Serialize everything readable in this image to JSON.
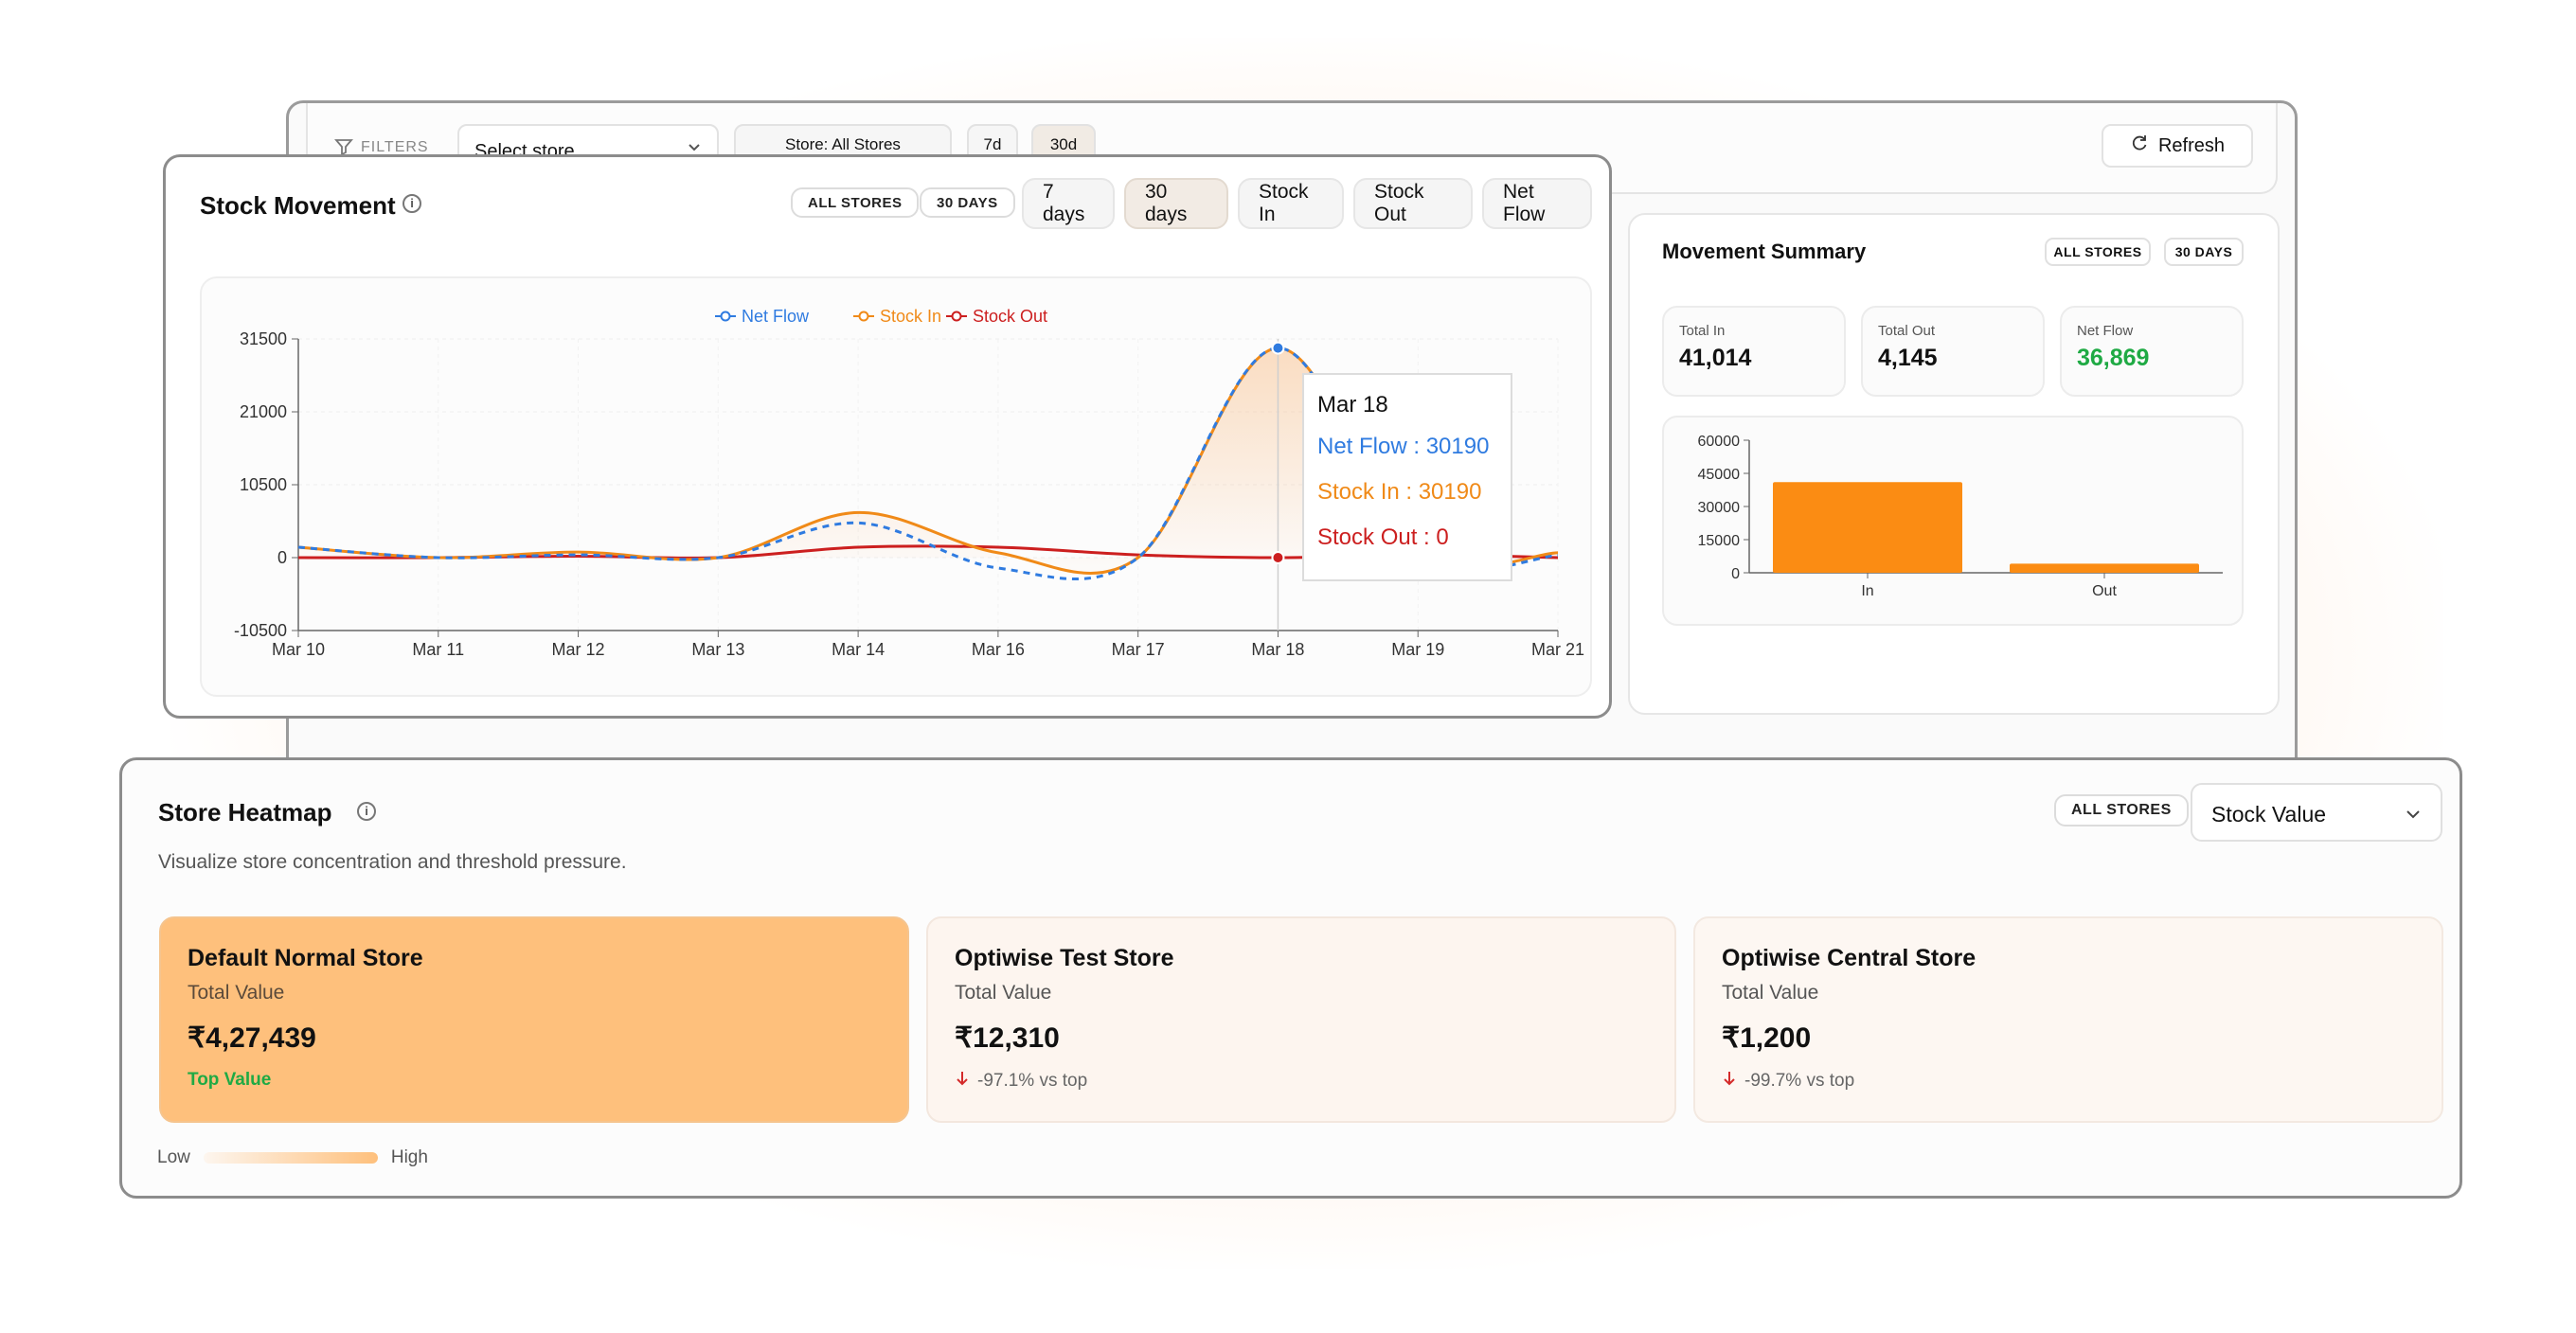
{
  "filters": {
    "label": "FILTERS",
    "store_select": "Select store",
    "chip_store": "Store: All Stores",
    "chip_7d": "7d",
    "chip_30d": "30d",
    "refresh": "Refresh"
  },
  "stock_movement": {
    "title": "Stock Movement",
    "chip_stores": "ALL STORES",
    "chip_days": "30 DAYS",
    "buttons": [
      "7 days",
      "30 days",
      "Stock In",
      "Stock Out",
      "Net Flow"
    ],
    "active_button": "30 days",
    "tooltip": {
      "date": "Mar 18",
      "net_flow": "Net Flow : 30190",
      "stock_in": "Stock In : 30190",
      "stock_out": "Stock Out : 0"
    }
  },
  "chart_data": [
    {
      "type": "line",
      "title": "",
      "x": [
        "Mar 10",
        "Mar 11",
        "Mar 12",
        "Mar 13",
        "Mar 14",
        "Mar 16",
        "Mar 17",
        "Mar 18",
        "Mar 19",
        "Mar 21"
      ],
      "series": [
        {
          "name": "Net Flow",
          "color": "#2f7be0",
          "values": [
            1500,
            0,
            400,
            0,
            5000,
            -1500,
            0,
            30190,
            500,
            300
          ]
        },
        {
          "name": "Stock In",
          "color": "#f08a18",
          "values": [
            1500,
            0,
            800,
            0,
            6500,
            700,
            0,
            30190,
            900,
            700
          ]
        },
        {
          "name": "Stock Out",
          "color": "#cc1f1f",
          "values": [
            0,
            0,
            200,
            0,
            1500,
            1500,
            400,
            0,
            400,
            0
          ]
        }
      ],
      "yticks": [
        31500,
        21000,
        10500,
        0,
        -10500
      ],
      "ylim": [
        -10500,
        31500
      ],
      "legend": "top-center",
      "grid": true
    },
    {
      "type": "bar",
      "title": "",
      "categories": [
        "In",
        "Out"
      ],
      "values": [
        41014,
        4145
      ],
      "color": "#fb8c13",
      "yticks": [
        60000,
        45000,
        30000,
        15000,
        0
      ],
      "ylim": [
        0,
        60000
      ]
    }
  ],
  "movement_summary": {
    "title": "Movement Summary",
    "chip_stores": "ALL STORES",
    "chip_days": "30 DAYS",
    "total_in_label": "Total In",
    "total_in": "41,014",
    "total_out_label": "Total Out",
    "total_out": "4,145",
    "net_flow_label": "Net Flow",
    "net_flow": "36,869",
    "net_color": "#1faa44"
  },
  "heatmap": {
    "title": "Store Heatmap",
    "subtitle": "Visualize store concentration and threshold pressure.",
    "chip_stores": "ALL STORES",
    "metric_select": "Stock Value",
    "stores": [
      {
        "name": "Default Normal Store",
        "label": "Total Value",
        "value": "₹4,27,439",
        "note": "Top Value"
      },
      {
        "name": "Optiwise Test Store",
        "label": "Total Value",
        "value": "₹12,310",
        "note": "-97.1% vs top"
      },
      {
        "name": "Optiwise Central Store",
        "label": "Total Value",
        "value": "₹1,200",
        "note": "-99.7% vs top"
      }
    ],
    "legend_low": "Low",
    "legend_high": "High"
  }
}
